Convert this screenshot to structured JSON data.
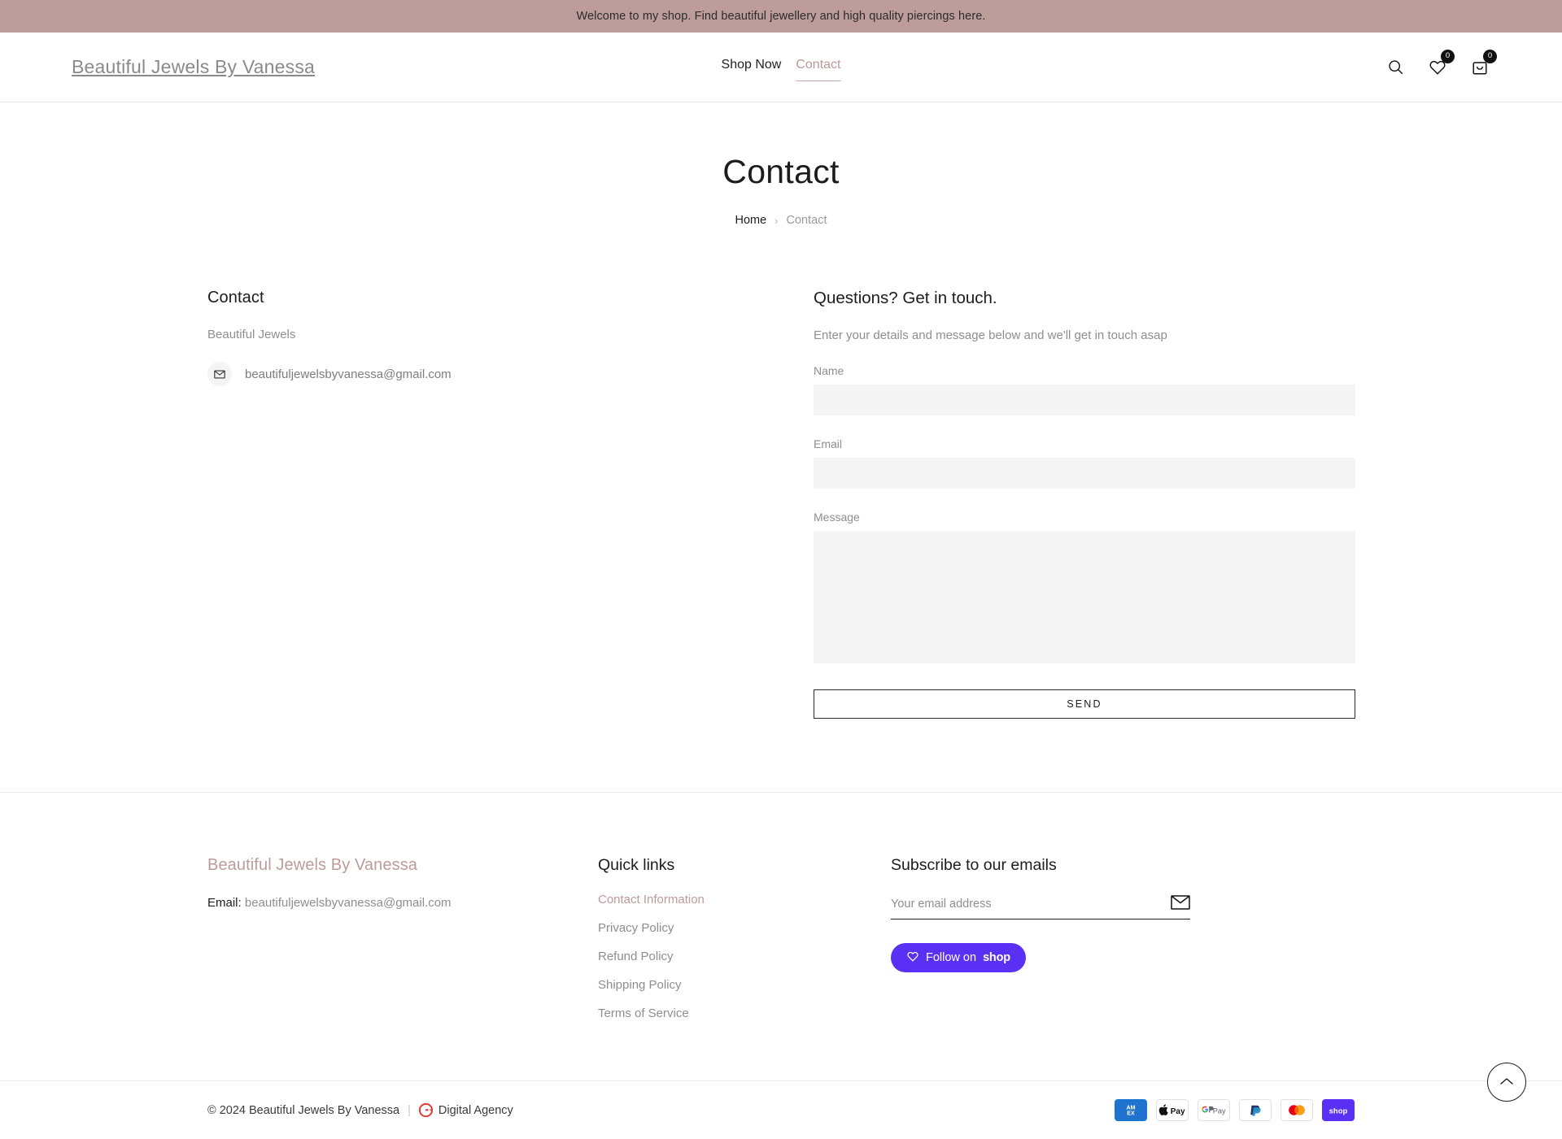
{
  "announcement": {
    "text": "Welcome to my shop. Find beautiful jewellery and high quality piercings here.",
    "background": "#bd9d9b"
  },
  "header": {
    "logo": "Beautiful Jewels By Vanessa",
    "nav": [
      {
        "label": "Shop Now",
        "active": false
      },
      {
        "label": "Contact",
        "active": true
      }
    ],
    "icons": {
      "search": "search-icon",
      "wishlist": "heart-icon",
      "wishlist_count": "0",
      "cart": "shopping-bag-icon",
      "cart_count": "0"
    }
  },
  "page": {
    "title": "Contact",
    "breadcrumb": {
      "home": "Home",
      "separator": "›",
      "current": "Contact"
    }
  },
  "contact_info": {
    "heading": "Contact",
    "company": "Beautiful Jewels",
    "email_icon": "envelope-icon",
    "email": "beautifuljewelsbyvanessa@gmail.com"
  },
  "contact_form": {
    "heading": "Questions? Get in touch.",
    "description": "Enter your details and message below and we'll get in touch asap",
    "fields": [
      {
        "label": "Name",
        "value": "",
        "placeholder": ""
      },
      {
        "label": "Email",
        "value": "",
        "placeholder": ""
      },
      {
        "label": "Message",
        "value": "",
        "placeholder": ""
      }
    ],
    "submit_label": "SEND"
  },
  "footer": {
    "brand": "Beautiful Jewels By Vanessa",
    "brand_color": "#bb9c9a",
    "email_label": "Email:",
    "email_value": "beautifuljewelsbyvanessa@gmail.com",
    "quick_links_heading": "Quick links",
    "quick_links": [
      {
        "label": "Contact Information",
        "current": true
      },
      {
        "label": "Privacy Policy",
        "current": false
      },
      {
        "label": "Refund Policy",
        "current": false
      },
      {
        "label": "Shipping Policy",
        "current": false
      },
      {
        "label": "Terms of Service",
        "current": false
      }
    ],
    "subscribe_heading": "Subscribe to our emails",
    "subscribe_placeholder": "Your email address",
    "subscribe_value": "",
    "subscribe_icon": "envelope-icon",
    "follow_button": {
      "prefix": "Follow on",
      "brand": "shop",
      "color": "#5a31f4",
      "icon": "heart-icon"
    }
  },
  "bottom": {
    "copyright": "© 2024 Beautiful Jewels By Vanessa",
    "divider": "|",
    "agency_icon": "g-logo-icon",
    "agency": "Digital Agency",
    "payments": [
      {
        "name": "American Express",
        "key": "amex"
      },
      {
        "name": "Apple Pay",
        "key": "applepay"
      },
      {
        "name": "Google Pay",
        "key": "googlepay"
      },
      {
        "name": "PayPal",
        "key": "paypal"
      },
      {
        "name": "Mastercard",
        "key": "mastercard"
      },
      {
        "name": "Shop Pay",
        "key": "shoppay"
      }
    ]
  },
  "scroll_top": {
    "icon": "chevron-up-icon"
  }
}
